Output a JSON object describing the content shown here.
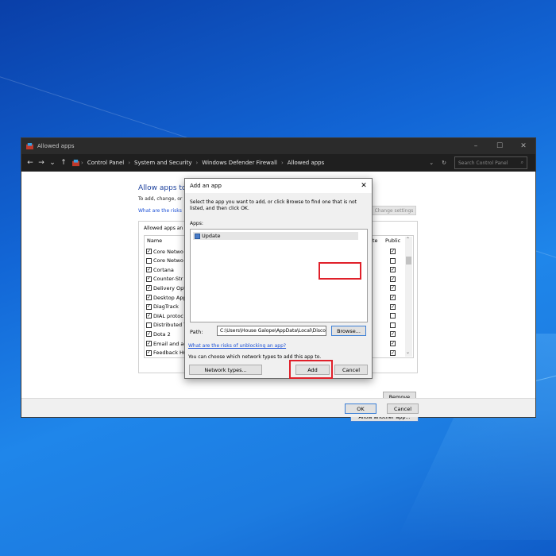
{
  "window": {
    "title": "Allowed apps",
    "minimize_glyph": "–",
    "maximize_glyph": "☐",
    "close_glyph": "✕"
  },
  "address": {
    "back": "←",
    "forward": "→",
    "recent": "⌄",
    "up": "↑",
    "breadcrumbs": [
      "Control Panel",
      "System and Security",
      "Windows Defender Firewall",
      "Allowed apps"
    ],
    "search_placeholder": "Search Control Panel",
    "dropdown_glyph": "⌄",
    "refresh_glyph": "↻",
    "search_glyph": "⌕"
  },
  "main": {
    "heading": "Allow apps to",
    "subtext": "To add, change, or",
    "risk_link": "What are the risks",
    "change_settings": "Change settings",
    "group_label": "Allowed apps an",
    "col_name": "Name",
    "col_private_tail": "te",
    "col_public": "Public",
    "rows": [
      {
        "name": "Core Netwo",
        "checked": true,
        "public": true
      },
      {
        "name": "Core Netwo",
        "checked": false,
        "public": false
      },
      {
        "name": "Cortana",
        "checked": true,
        "public": true
      },
      {
        "name": "Counter-Str",
        "checked": true,
        "public": true
      },
      {
        "name": "Delivery Opt",
        "checked": true,
        "public": true
      },
      {
        "name": "Desktop App",
        "checked": true,
        "public": true
      },
      {
        "name": "DiagTrack",
        "checked": true,
        "public": true
      },
      {
        "name": "DIAL protoc",
        "checked": true,
        "public": false
      },
      {
        "name": "Distributed T",
        "checked": false,
        "public": false
      },
      {
        "name": "Dota 2",
        "checked": true,
        "public": true
      },
      {
        "name": "Email and ac",
        "checked": true,
        "public": true
      },
      {
        "name": "Feedback Hu",
        "checked": true,
        "public": true
      }
    ],
    "remove": "Remove",
    "allow_another": "Allow another app...",
    "ok": "OK",
    "cancel": "Cancel"
  },
  "dialog": {
    "title": "Add an app",
    "close_glyph": "✕",
    "description": "Select the app you want to add, or click Browse to find one that is not listed, and then click OK.",
    "apps_label": "Apps:",
    "apps": [
      "Update"
    ],
    "path_label": "Path:",
    "path_value": "C:\\Users\\House Galope\\AppData\\Local\\Discor",
    "browse": "Browse...",
    "risk_link": "What are the risks of unblocking an app?",
    "choose_text": "You can choose which network types to add this app to.",
    "network_types": "Network types...",
    "add": "Add",
    "cancel": "Cancel"
  },
  "colors": {
    "highlight_box": "#e0202a",
    "link": "#1a4fd6",
    "heading": "#1a3f9c"
  }
}
